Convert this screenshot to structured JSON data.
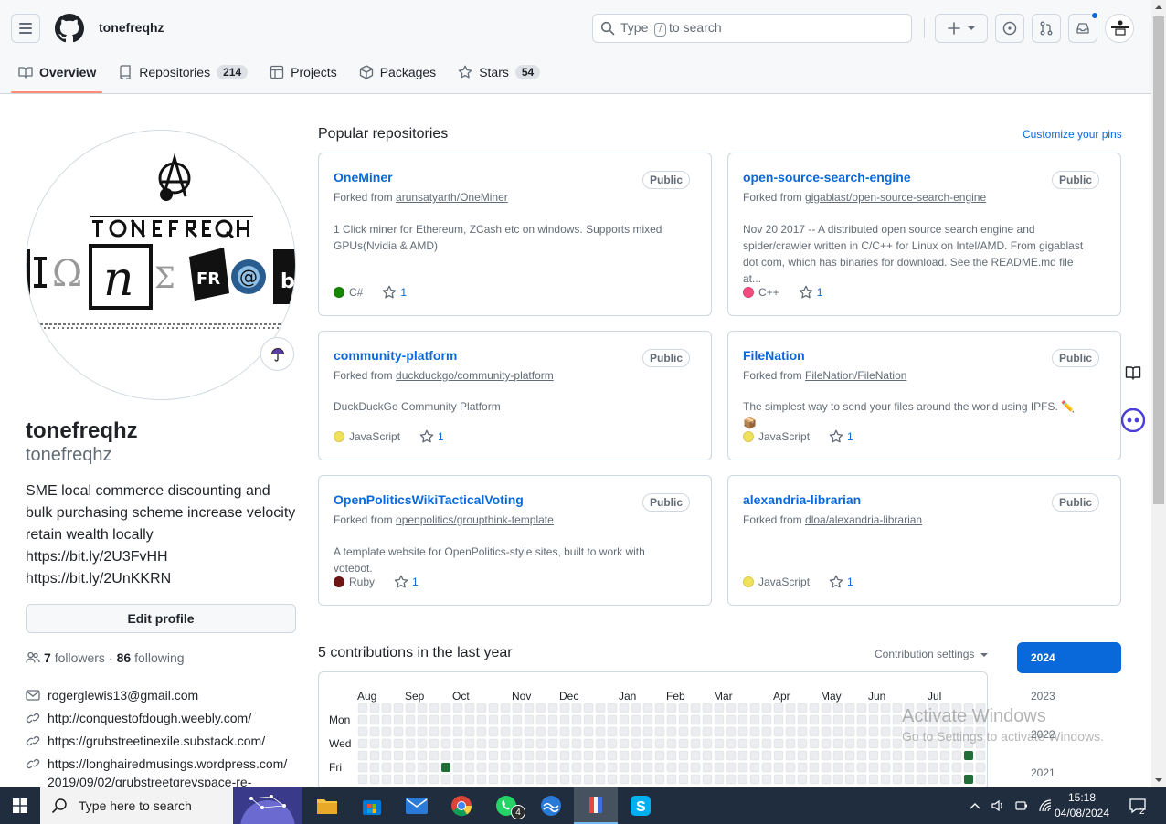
{
  "header": {
    "username": "tonefreqhz",
    "search_placeholder_prefix": "Type",
    "search_key": "/",
    "search_placeholder_suffix": "to search"
  },
  "tabs": [
    {
      "label": "Overview",
      "count": null,
      "icon": "book-icon",
      "active": true
    },
    {
      "label": "Repositories",
      "count": "214",
      "icon": "repo-icon"
    },
    {
      "label": "Projects",
      "count": null,
      "icon": "table-icon"
    },
    {
      "label": "Packages",
      "count": null,
      "icon": "package-icon"
    },
    {
      "label": "Stars",
      "count": "54",
      "icon": "star-icon"
    }
  ],
  "profile": {
    "name": "tonefreqhz",
    "login": "tonefreqhz",
    "bio_lines": [
      "SME local commerce discounting and",
      "bulk purchasing scheme increase velocity",
      "retain wealth locally",
      "https://bit.ly/2U3FvHH",
      "https://bit.ly/2UnKKRN"
    ],
    "edit_label": "Edit profile",
    "followers_count": "7",
    "followers_label": "followers",
    "following_count": "86",
    "following_label": "following",
    "email": "rogerglewis13@gmail.com",
    "links": [
      "http://conquestofdough.weebly.com/",
      "https://grubstreetinexile.substack.com/",
      "https://longhairedmusings.wordpress.com/",
      "2019/09/02/grubstreetgreyspace-re-"
    ],
    "avatar_text": "TONEFREQHZ"
  },
  "popular": {
    "title": "Popular repositories",
    "customize": "Customize your pins",
    "repos": [
      {
        "name": "OneMiner",
        "visibility": "Public",
        "forked_label": "Forked from",
        "forked_from": "arunsatyarth/OneMiner",
        "desc": [
          "1 Click miner for Ethereum, ZCash etc on windows. Supports mixed",
          "GPUs(Nvidia & AMD)"
        ],
        "lang": "C#",
        "lang_color": "#178600",
        "stars": "1"
      },
      {
        "name": "open-source-search-engine",
        "visibility": "Public",
        "forked_label": "Forked from",
        "forked_from": "gigablast/open-source-search-engine",
        "desc": [
          "Nov 20 2017 -- A distributed open source search engine and",
          "spider/crawler written in C/C++ for Linux on Intel/AMD. From gigablast",
          "dot com, which has binaries for download. See the README.md file at..."
        ],
        "lang": "C++",
        "lang_color": "#f34b7d",
        "stars": "1"
      },
      {
        "name": "community-platform",
        "visibility": "Public",
        "forked_label": "Forked from",
        "forked_from": "duckduckgo/community-platform",
        "desc": [
          "DuckDuckGo Community Platform"
        ],
        "lang": "JavaScript",
        "lang_color": "#f1e05a",
        "stars": "1"
      },
      {
        "name": "FileNation",
        "visibility": "Public",
        "forked_label": "Forked from",
        "forked_from": "FileNation/FileNation",
        "desc": [
          "The simplest way to send your files around the world using IPFS. ✏️ 📦"
        ],
        "lang": "JavaScript",
        "lang_color": "#f1e05a",
        "stars": "1"
      },
      {
        "name": "OpenPoliticsWikiTacticalVoting",
        "visibility": "Public",
        "forked_label": "Forked from",
        "forked_from": "openpolitics/groupthink-template",
        "desc": [
          "A template website for OpenPolitics-style sites, built to work with votebot."
        ],
        "lang": "Ruby",
        "lang_color": "#701516",
        "stars": "1"
      },
      {
        "name": "alexandria-librarian",
        "visibility": "Public",
        "forked_label": "Forked from",
        "forked_from": "dloa/alexandria-librarian",
        "desc": [],
        "lang": "JavaScript",
        "lang_color": "#f1e05a",
        "stars": "1"
      }
    ]
  },
  "contributions": {
    "title": "5 contributions in the last year",
    "settings": "Contribution settings",
    "months": [
      "Aug",
      "Sep",
      "Oct",
      "Nov",
      "Dec",
      "Jan",
      "Feb",
      "Mar",
      "Apr",
      "May",
      "Jun",
      "Jul"
    ],
    "days": [
      "Mon",
      "Wed",
      "Fri"
    ],
    "years": [
      "2024",
      "2023",
      "2022",
      "2021"
    ],
    "selected_year": "2024"
  },
  "watermark": {
    "line1": "Activate Windows",
    "line2": "Go to Settings to activate Windows."
  },
  "taskbar": {
    "search_placeholder": "Type here to search",
    "whatsapp_badge": "4",
    "time": "15:18",
    "date": "04/08/2024",
    "notif_count": "2"
  }
}
